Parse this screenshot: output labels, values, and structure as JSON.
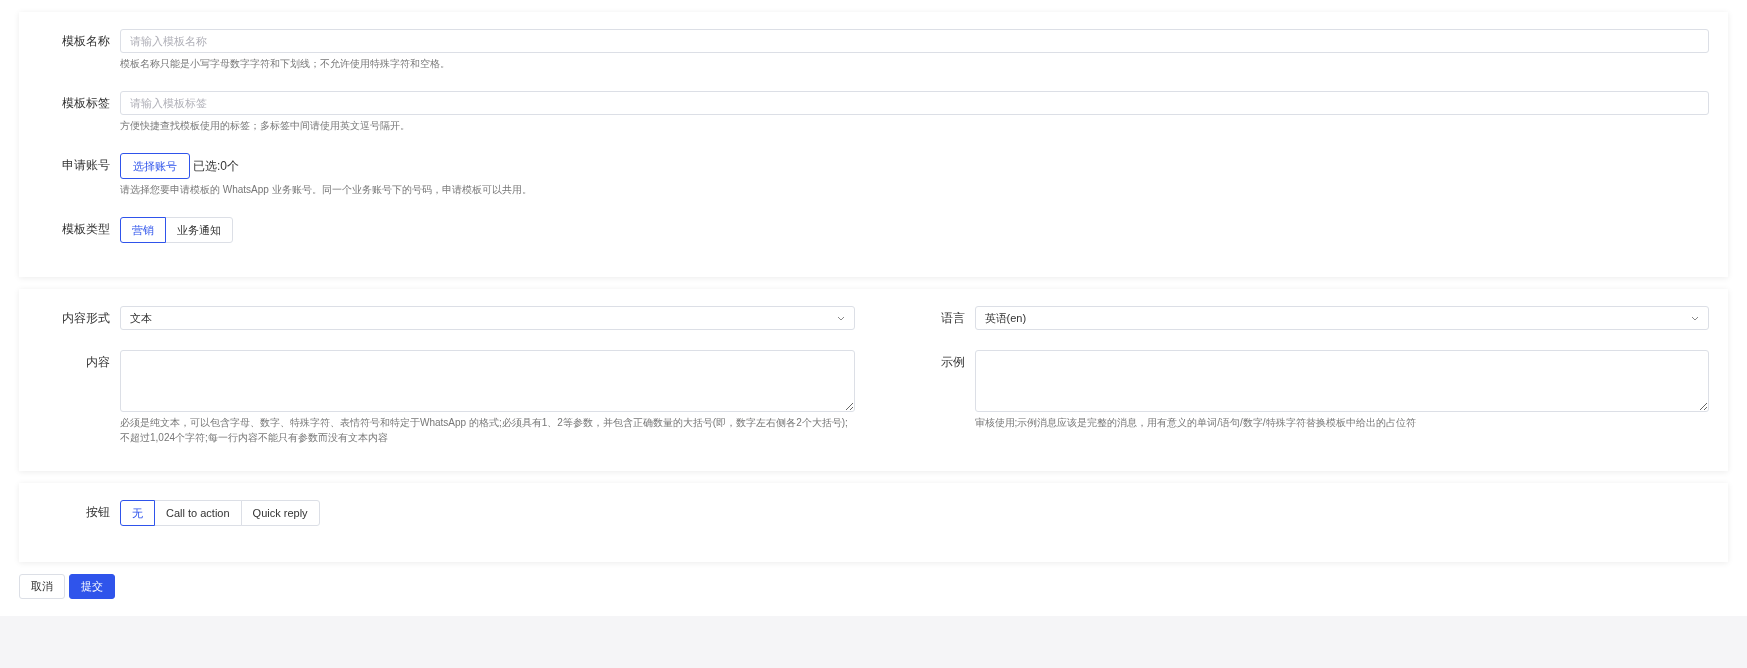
{
  "sections": [
    {
      "columns": [
        [
          {
            "kind": "input",
            "label": "模板名称",
            "placeholder": "请输入模板名称",
            "hint": "模板名称只能是小写字母数字字符和下划线；不允许使用特殊字符和空格。"
          },
          {
            "kind": "input",
            "label": "模板标签",
            "placeholder": "请输入模板标签",
            "hint": "方便快捷查找模板使用的标签；多标签中间请使用英文逗号隔开。"
          },
          {
            "kind": "account",
            "label": "申请账号",
            "button": "选择账号",
            "status": "已选:0个",
            "hint": "请选择您要申请模板的 WhatsApp 业务账号。同一个业务账号下的号码，申请模板可以共用。"
          },
          {
            "kind": "segmented",
            "label": "模板类型",
            "options": [
              {
                "label": "营销",
                "selected": true
              },
              {
                "label": "业务通知",
                "selected": false
              }
            ]
          }
        ]
      ]
    },
    {
      "columns": [
        [
          {
            "kind": "select",
            "label": "内容形式",
            "value": "文本"
          },
          {
            "kind": "textarea",
            "label": "内容",
            "hint": "必须是纯文本，可以包含字母、数字、特殊字符、表情符号和特定于WhatsApp 的格式;必须具有1、2等参数，并包含正确数量的大括号(即，数字左右侧各2个大括号);不超过1,024个字符;每一行内容不能只有参数而没有文本内容"
          }
        ],
        [
          {
            "kind": "select",
            "label": "语言",
            "value": "英语(en)"
          },
          {
            "kind": "textarea",
            "label": "示例",
            "hint": "审核使用;示例消息应该是完整的消息，用有意义的单词/语句/数字/特殊字符替换模板中给出的占位符"
          }
        ]
      ]
    },
    {
      "columns": [
        [
          {
            "kind": "segmented",
            "label": "按钮",
            "options": [
              {
                "label": "无",
                "selected": true
              },
              {
                "label": "Call to action",
                "selected": false
              },
              {
                "label": "Quick reply",
                "selected": false
              }
            ]
          }
        ]
      ]
    }
  ],
  "actions": [
    {
      "label": "取消",
      "kind": "default"
    },
    {
      "label": "提交",
      "kind": "primary"
    }
  ]
}
